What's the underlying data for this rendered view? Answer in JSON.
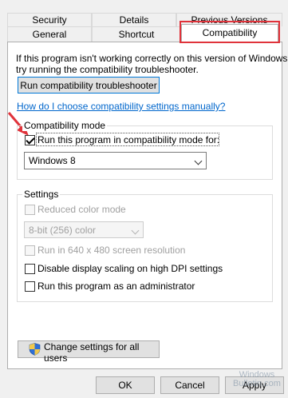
{
  "tabs_row1": [
    {
      "label": "Security"
    },
    {
      "label": "Details"
    },
    {
      "label": "Previous Versions"
    }
  ],
  "tabs_row2": [
    {
      "label": "General"
    },
    {
      "label": "Shortcut"
    },
    {
      "label": "Compatibility",
      "active": true
    }
  ],
  "intro_text": "If this program isn't working correctly on this version of Windows, try running the compatibility troubleshooter.",
  "intro_line1": "If this program isn't working correctly on this version of Windows,",
  "intro_line2": "try running the compatibility troubleshooter.",
  "troubleshooter_button": "Run compatibility troubleshooter",
  "help_link": "How do I choose compatibility settings manually?",
  "compat_mode": {
    "title": "Compatibility mode",
    "checkbox_label": "Run this program in compatibility mode for:",
    "checked": true,
    "selected_os": "Windows 8"
  },
  "settings": {
    "title": "Settings",
    "reduced_color": {
      "label": "Reduced color mode",
      "checked": false,
      "enabled": false
    },
    "color_depth": {
      "value": "8-bit (256) color",
      "enabled": false
    },
    "res_640": {
      "label": "Run in 640 x 480 screen resolution",
      "checked": false,
      "enabled": false
    },
    "disable_dpi": {
      "label": "Disable display scaling on high DPI settings",
      "checked": false,
      "enabled": true
    },
    "run_admin": {
      "label": "Run this program as an administrator",
      "checked": false,
      "enabled": true
    }
  },
  "change_all_users_button": "Change settings for all users",
  "footer": {
    "ok": "OK",
    "cancel": "Cancel",
    "apply": "Apply"
  },
  "watermark": {
    "line1": "Windows",
    "line2": "Bulletin.com"
  },
  "colors": {
    "highlight": "#e0333b",
    "link": "#0066cc",
    "arrow": "#e0333b"
  },
  "icons": {
    "shield": "uac-shield-icon",
    "arrow": "red-pointer-arrow",
    "dropdown": "chevron-down-icon"
  }
}
